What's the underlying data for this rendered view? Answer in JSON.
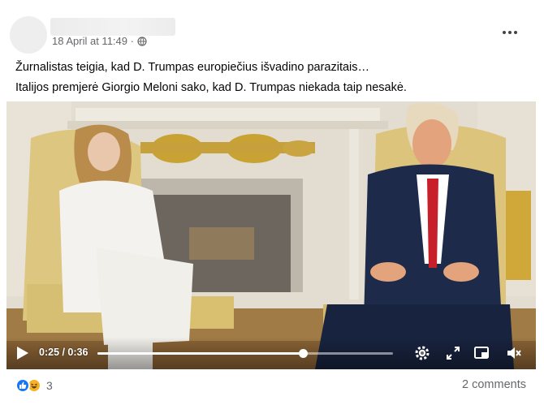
{
  "post": {
    "timestamp": "18 April at 11:49 ·",
    "privacy_icon": "globe-icon",
    "menu_icon": "more-horizontal-icon",
    "text_lines": [
      "Žurnalistas teigia, kad D. Trumpas europiečius išvadino parazitais…",
      "Italijos premjerė Giorgio Meloni sako, kad D. Trumpas niekada taip nesakė."
    ]
  },
  "video": {
    "current_time": "0:25",
    "separator": "/",
    "duration": "0:36",
    "time_display": "0:25 / 0:36",
    "progress_fraction": 0.694,
    "controls": [
      "play-icon",
      "settings-icon",
      "fullscreen-icon",
      "picture-in-picture-icon",
      "mute-icon"
    ]
  },
  "footer": {
    "reaction_icons": [
      "like-icon",
      "haha-icon"
    ],
    "reaction_count": "3",
    "comments_label": "2 comments"
  },
  "colors": {
    "accent": "#1877f2",
    "secondary_text": "#65676b",
    "primary_text": "#050505"
  }
}
